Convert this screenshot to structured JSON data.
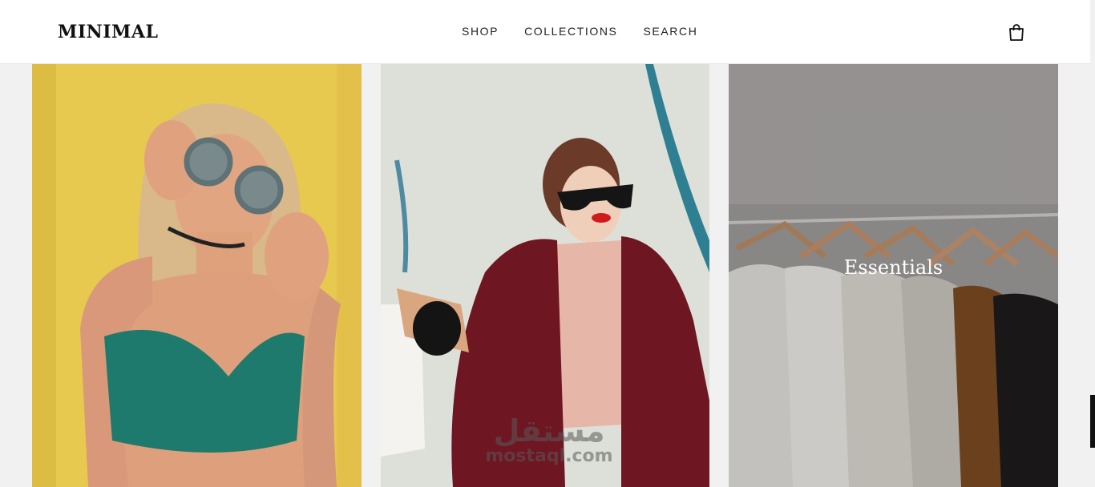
{
  "brand": {
    "logo": "MINIMAL"
  },
  "nav": {
    "items": [
      "SHOP",
      "COLLECTIONS",
      "SEARCH"
    ]
  },
  "header": {
    "cart_icon": "shopping-bag-icon"
  },
  "tiles": [
    {
      "caption": ""
    },
    {
      "caption": ""
    },
    {
      "caption": "Essentials"
    }
  ],
  "watermark": {
    "arabic": "مستقل",
    "latin": "mostaql.com"
  },
  "colors": {
    "header_bg": "#ffffff",
    "page_bg": "#f1f1f1",
    "tile1_bg": "#e8c94f",
    "tile2_bg": "#dde0d8",
    "tile3_bg": "#9d9a98"
  }
}
